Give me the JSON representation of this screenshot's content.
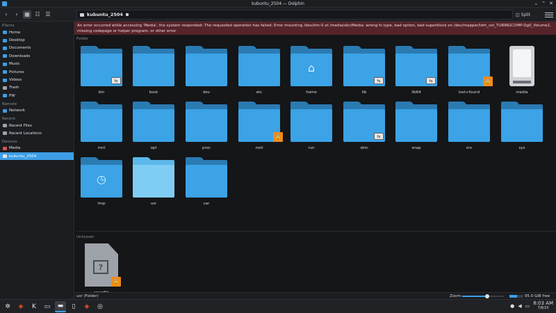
{
  "window": {
    "title": "kubuntu_2504 — Dolphin"
  },
  "toolbar": {
    "location": "kubuntu_2504",
    "split_label": "Split"
  },
  "error": {
    "message": "An error occurred while accessing 'Media', the system responded: The requested operation has failed: Error mounting /dev/dm-0 at /media/skc/Media: wrong fs type, bad option, bad superblock on /dev/mapper/ldm_vol_TURINGCOMP-Dg0_Volume2, missing codepage or helper program, or other error"
  },
  "sidebar": {
    "sections": [
      {
        "title": "Places",
        "items": [
          {
            "label": "Home",
            "color": "#3d9ee6"
          },
          {
            "label": "Desktop",
            "color": "#3d9ee6"
          },
          {
            "label": "Documents",
            "color": "#3d9ee6"
          },
          {
            "label": "Downloads",
            "color": "#3d9ee6"
          },
          {
            "label": "Music",
            "color": "#3d9ee6"
          },
          {
            "label": "Pictures",
            "color": "#3d9ee6"
          },
          {
            "label": "Videos",
            "color": "#3d9ee6"
          },
          {
            "label": "Trash",
            "color": "#9ea3a9"
          },
          {
            "label": "PW",
            "color": "#3d9ee6"
          }
        ]
      },
      {
        "title": "Remote",
        "items": [
          {
            "label": "Network",
            "color": "#3d9ee6"
          }
        ]
      },
      {
        "title": "Recent",
        "items": [
          {
            "label": "Recent Files",
            "color": "#9ea3a9"
          },
          {
            "label": "Recent Locations",
            "color": "#9ea3a9"
          }
        ]
      },
      {
        "title": "Devices",
        "items": [
          {
            "label": "Media",
            "color": "#d65050"
          },
          {
            "label": "kubuntu_2504",
            "color": "#e0e2e5",
            "selected": true
          }
        ]
      }
    ]
  },
  "groups": {
    "folder_label": "Folder",
    "unknown_label": "Unknown"
  },
  "items": [
    {
      "name": "bin",
      "kind": "folder",
      "emblem": "link"
    },
    {
      "name": "boot",
      "kind": "folder"
    },
    {
      "name": "dev",
      "kind": "folder"
    },
    {
      "name": "etc",
      "kind": "folder"
    },
    {
      "name": "home",
      "kind": "folder",
      "glyph": "home-icon"
    },
    {
      "name": "lib",
      "kind": "folder",
      "emblem": "link"
    },
    {
      "name": "lib64",
      "kind": "folder",
      "emblem": "link"
    },
    {
      "name": "lost+found",
      "kind": "folder",
      "emblem": "lock"
    },
    {
      "name": "media",
      "kind": "drive"
    },
    {
      "name": "mnt",
      "kind": "folder"
    },
    {
      "name": "opt",
      "kind": "folder"
    },
    {
      "name": "proc",
      "kind": "folder"
    },
    {
      "name": "root",
      "kind": "folder",
      "emblem": "lock"
    },
    {
      "name": "run",
      "kind": "folder"
    },
    {
      "name": "sbin",
      "kind": "folder",
      "emblem": "link"
    },
    {
      "name": "snap",
      "kind": "folder"
    },
    {
      "name": "srv",
      "kind": "folder"
    },
    {
      "name": "sys",
      "kind": "folder"
    },
    {
      "name": "tmp",
      "kind": "folder",
      "glyph": "clock-icon"
    },
    {
      "name": "usr",
      "kind": "folder",
      "highlight": true
    },
    {
      "name": "var",
      "kind": "folder"
    }
  ],
  "unknown_items": [
    {
      "name": "swapfile",
      "kind": "unknown",
      "emblem": "lock"
    }
  ],
  "status": {
    "selection": "usr (Folder)",
    "zoom_label": "Zoom:",
    "zoom_fraction": 0.6,
    "disk_used_fraction": 0.55,
    "free_space": "95.0 GiB free"
  },
  "taskbar": {
    "apps": [
      "kde-launcher-icon",
      "brave-icon",
      "kde-icon",
      "terminal-icon",
      "dolphin-icon",
      "files-icon",
      "brave-icon",
      "app-icon"
    ],
    "clock_time": "8:03 AM",
    "clock_date": "7/8/25"
  }
}
